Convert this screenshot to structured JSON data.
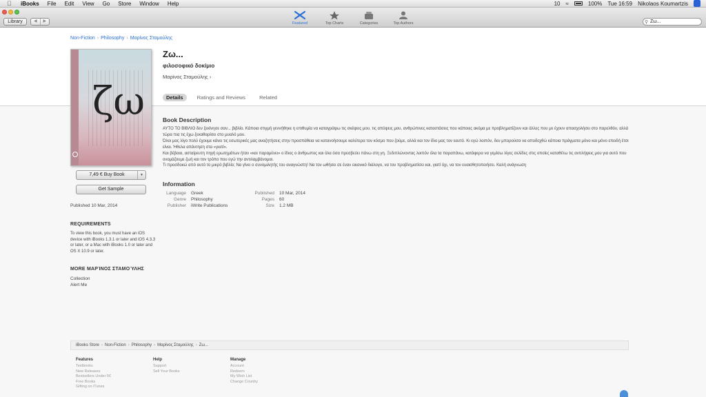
{
  "menubar": {
    "app": "iBooks",
    "menus": [
      "File",
      "Edit",
      "View",
      "Go",
      "Store",
      "Window",
      "Help"
    ],
    "status": {
      "num": "10",
      "battery": "100%",
      "time": "Tue 16:59",
      "user": "Nikolaos Koumartzis"
    }
  },
  "toolbar": {
    "library": "Library",
    "back": "◀",
    "forward": "▶",
    "tabs": [
      "Featured",
      "Top Charts",
      "Categories",
      "Top Authors"
    ],
    "search_value": "Ζω..."
  },
  "breadcrumb": [
    "Non-Fiction",
    "Philosophy",
    "Μαρίνος Σταμούλης"
  ],
  "book": {
    "title": "Ζω...",
    "subtitle": "φιλοσοφικό δοκίμιο",
    "author": "Μαρίνος Σταμούλης ›",
    "cover_glyph": "ζω",
    "buy_label": "7,49 € Buy Book",
    "buy_arrow": "▼",
    "sample_label": "Get Sample",
    "published_side": "Published 10 Mar, 2014"
  },
  "sidebar": {
    "requirements_heading": "REQUIREMENTS",
    "requirements_text": "To view this book, you must have an iOS device with iBooks 1.3.1 or later and iOS 4.3.3 or later, or a Mac with iBooks 1.0 or later and OS X 10.9 or later.",
    "more_heading": "MORE ΜΑΡΊΝΟΣ ΣΤΑΜΟΎΛΗΣ",
    "links": [
      "Collection",
      "Alert Me"
    ]
  },
  "tabs": [
    "Details",
    "Ratings and Reviews",
    "Related"
  ],
  "description": {
    "heading": "Book Description",
    "paragraphs": [
      "ΑΥΤΟ ΤΟ ΒΙΒΛΙΟ δεν ξεκίνησε σαν... βιβλίο. Κάποια στιγμή γεννήθηκε η επιθυμία να καταγράψω τις σκέψεις μου, τις απόψεις μου, ανθρώπινες καταστάσεις που κάποιες ακόμα με προβληματίζουν και άλλες που με έχουν απασχολήσει στο παρελθόν, αλλά τώρα πια τις έχω ξεκαθαρίσει στο μυαλό μου.",
      "Όλοι μας λίγο πολύ έχουμε κάνει τις εσωτερικές μας αναζητήσεις στην προσπάθεια να κατανοήσουμε καλύτερα τον κόσμο που ζούμε, αλλά και τον ίδιο μας τον εαυτό. Κι εγώ λοιπόν, δεν μπορούσα να αποδεχθώ κάποια πράγματα μόνο και μόνο επειδή έτσι είναι. Ήθελα απάντηση στα «γιατί».",
      "Και βέβαια, ασταίρευτη πηγή ερωτημάτων ήταν «και παραμένει» ο ίδιος ο άνθρωπος και όλα όσα πρεσβεύει πάνω στη γη. Ξεδιπλώνοντας λοιπόν όλα τα παραπάνω, κατάφερα να γεμίσω λίγες σελίδες στις οποίες καταθέτω τις αντιλήψεις μου για αυτό που ονομάζουμε ζωή και τον τρόπο που εγώ την αντιλαμβάνομαι.",
      "Τι προσδοκώ από αυτό το μικρό βιβλίο; Να γίνει ο συνομιλητής του αναγνώστη! Να τον ωθήσει σε έναν εικονικό διάλογο, να τον προβληματίσει και, γιατί όχι, να τον ευαισθητοποιήσει. Καλή ανάγνωση"
    ]
  },
  "information": {
    "heading": "Information",
    "left": [
      {
        "key": "Language",
        "value": "Greek"
      },
      {
        "key": "Genre",
        "value": "Philosophy"
      },
      {
        "key": "Publisher",
        "value": "iWrite Publications"
      }
    ],
    "right": [
      {
        "key": "Published",
        "value": "10 Mar, 2014"
      },
      {
        "key": "Pages",
        "value": "60"
      },
      {
        "key": "Size",
        "value": "1.2 MB"
      }
    ]
  },
  "footer": {
    "crumb": [
      "iBooks Store",
      "Non-Fiction",
      "Philosophy",
      "Μαρίνος Σταμούλης",
      "Ζω..."
    ],
    "columns": [
      {
        "heading": "Features",
        "links": [
          "Textbooks",
          "New Releases",
          "Bestsellers Under 5€",
          "Free Books",
          "Gifting on iTunes"
        ]
      },
      {
        "heading": "Help",
        "links": [
          "Support",
          "Sell Your Books"
        ]
      },
      {
        "heading": "Manage",
        "links": [
          "Account",
          "Redeem",
          "My Wish List",
          "Change Country"
        ]
      }
    ]
  },
  "colors": {
    "link": "#2a6fd6",
    "accent_tab": "#2a6fd6"
  }
}
